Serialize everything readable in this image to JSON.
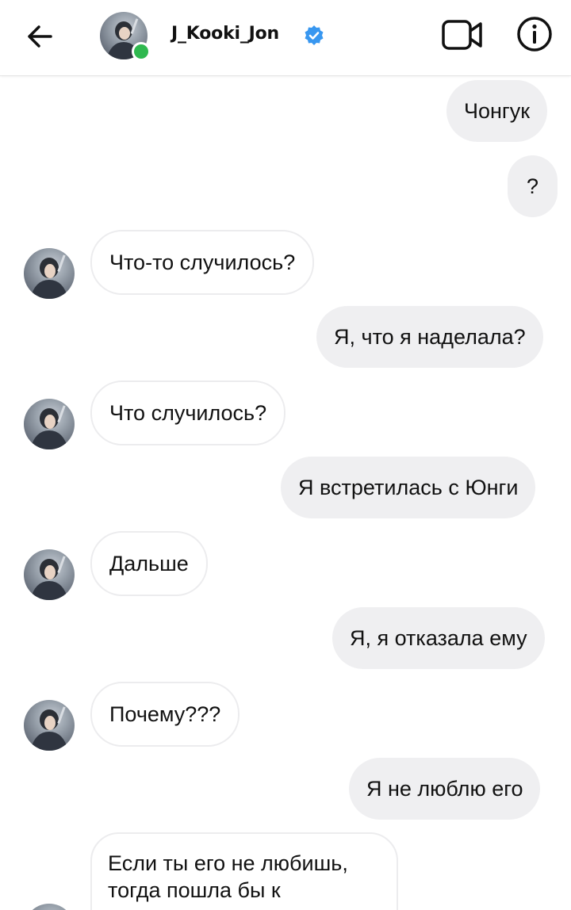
{
  "header": {
    "username": "J_Kooki_Jon",
    "online_color": "#2fb84f",
    "verified_color": "#3897f0",
    "back_icon": "arrow-left-icon",
    "video_icon": "video-camera-icon",
    "info_icon": "info-icon"
  },
  "messages": [
    {
      "side": "out",
      "text": "Чонгук"
    },
    {
      "side": "out",
      "text": "?"
    },
    {
      "side": "in",
      "text": "Что-то случилось?"
    },
    {
      "side": "out",
      "text": "Я, что я наделала?"
    },
    {
      "side": "in",
      "text": "Что случилось?"
    },
    {
      "side": "out",
      "text": "Я встретилась с Юнги"
    },
    {
      "side": "in",
      "text": "Дальше"
    },
    {
      "side": "out",
      "text": "Я, я отказала ему"
    },
    {
      "side": "in",
      "text": "Почему???"
    },
    {
      "side": "out",
      "text": "Я не люблю его"
    },
    {
      "side": "in",
      "text": "Если ты его не любишь, тогда пошла бы к"
    }
  ]
}
